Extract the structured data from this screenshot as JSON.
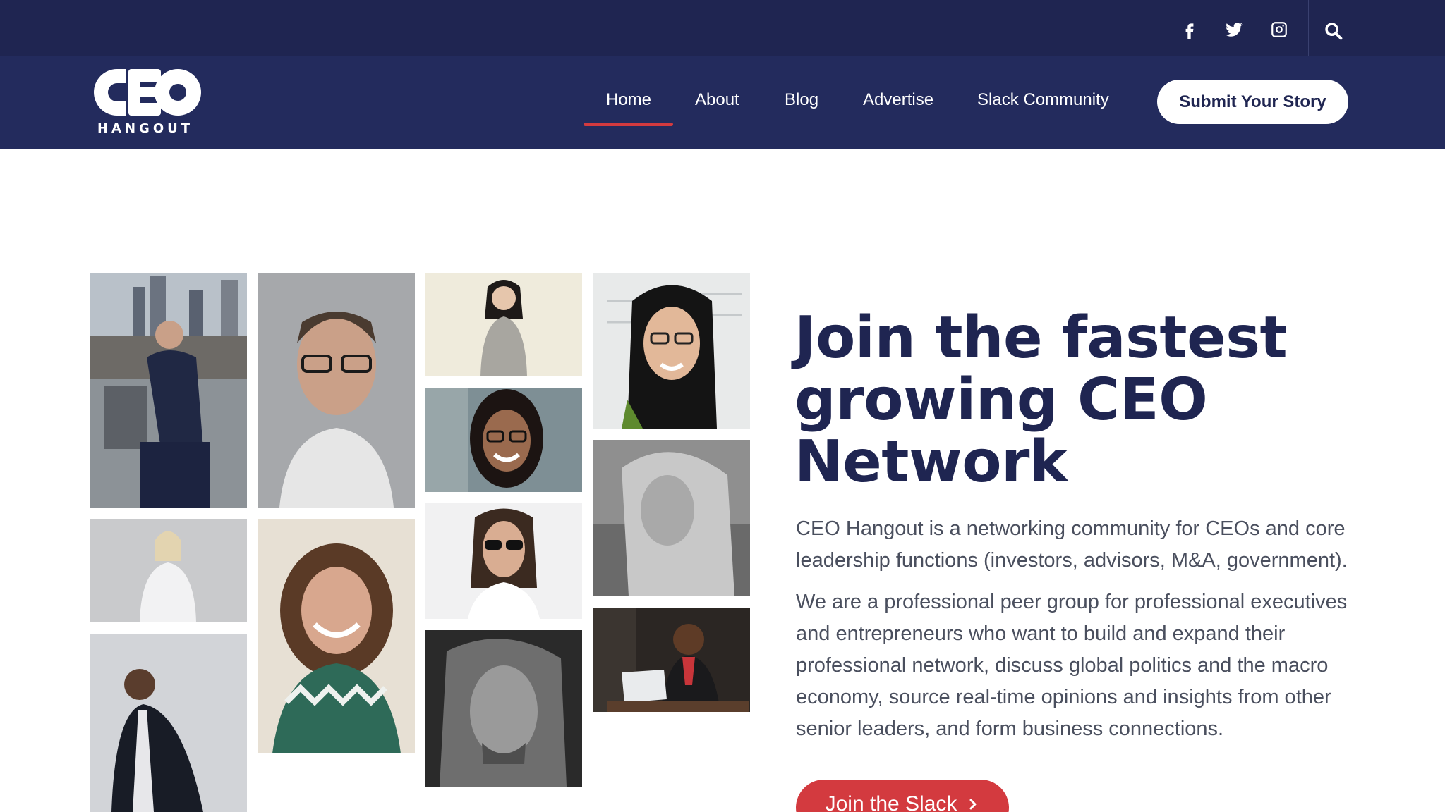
{
  "topbar": {
    "social": [
      {
        "name": "facebook-icon"
      },
      {
        "name": "twitter-icon"
      },
      {
        "name": "instagram-icon"
      }
    ],
    "search_icon": "search-icon"
  },
  "brand": {
    "logo_text": "CEO",
    "logo_subtext": "HANGOUT"
  },
  "nav": {
    "items": [
      {
        "label": "Home",
        "active": true
      },
      {
        "label": "About"
      },
      {
        "label": "Blog"
      },
      {
        "label": "Advertise"
      },
      {
        "label": "Slack Community"
      }
    ],
    "cta_label": "Submit Your Story"
  },
  "hero": {
    "title": "Join the fastest growing CEO Network",
    "paragraph_1": "CEO Hangout is a networking community for CEOs and core leadership functions (investors, advisors, M&A, government).",
    "paragraph_2": "We are a professional peer group for professional executives and entrepreneurs who want to build and expand their professional network, discuss global politics and the macro economy, source real-time opinions and insights from other senior leaders, and form business connections.",
    "cta_label": "Join the Slack"
  },
  "colors": {
    "topbar_bg": "#1f2551",
    "navbar_bg": "#232b5d",
    "accent_red": "#d33a3f",
    "title_navy": "#1f2551",
    "body_text": "#4a4f5e"
  }
}
